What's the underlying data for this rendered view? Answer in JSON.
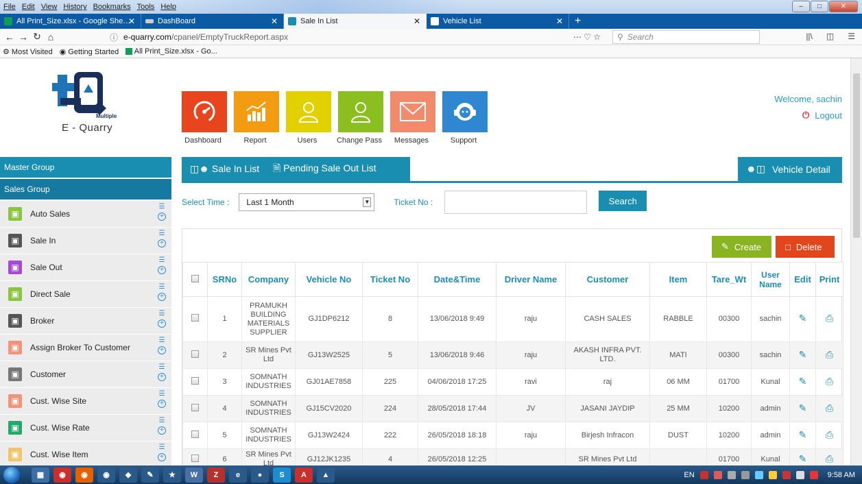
{
  "browser": {
    "menu": [
      "File",
      "Edit",
      "View",
      "History",
      "Bookmarks",
      "Tools",
      "Help"
    ],
    "tabs": [
      {
        "label": "All Print_Size.xlsx - Google She…",
        "color": "#0f9d58"
      },
      {
        "label": "DashBoard",
        "color": "#cccccc"
      },
      {
        "label": "Sale In List",
        "color": "#1a8eb0"
      },
      {
        "label": "Vehicle List",
        "color": "#1a8eb0"
      }
    ],
    "new_tab": "+",
    "url_domain": "e-quarry.com",
    "url_path": "/cpanel/EmptyTruckReport.aspx",
    "search_placeholder": "Search",
    "bookmarks": [
      "Most Visited",
      "Getting Started",
      "All Print_Size.xlsx - Go..."
    ]
  },
  "header": {
    "logo_brand": "E - Quarry",
    "logo_sub": "Multiple",
    "tiles": [
      {
        "label": "Dashboard",
        "color": "#e8451e",
        "icon": "speedometer-icon"
      },
      {
        "label": "Report",
        "color": "#f39c12",
        "icon": "bar-chart-icon"
      },
      {
        "label": "Users",
        "color": "#e3d000",
        "icon": "user-icon"
      },
      {
        "label": "Change Pass",
        "color": "#8bbf1f",
        "icon": "user-key-icon"
      },
      {
        "label": "Messages",
        "color": "#f28b6b",
        "icon": "envelope-icon"
      },
      {
        "label": "Support",
        "color": "#2f86d1",
        "icon": "headset-icon"
      }
    ],
    "welcome": "Welcome, sachin",
    "logout": "Logout"
  },
  "sidebar": {
    "master_group": "Master Group",
    "sales_group": "Sales Group",
    "items": [
      {
        "label": "Auto Sales",
        "color": "#8ac53f",
        "icon": "auto-sales-icon"
      },
      {
        "label": "Sale In",
        "color": "#555555",
        "icon": "sale-in-icon"
      },
      {
        "label": "Sale Out",
        "color": "#a64ad6",
        "icon": "sale-out-icon"
      },
      {
        "label": "Direct Sale",
        "color": "#8ac53f",
        "icon": "direct-sale-icon"
      },
      {
        "label": "Broker",
        "color": "#555555",
        "icon": "broker-icon"
      },
      {
        "label": "Assign Broker To Customer",
        "color": "#f4937a",
        "icon": "assign-broker-icon"
      },
      {
        "label": "Customer",
        "color": "#777777",
        "icon": "customer-icon"
      },
      {
        "label": "Cust. Wise Site",
        "color": "#f4937a",
        "icon": "cust-site-icon"
      },
      {
        "label": "Cust. Wise Rate",
        "color": "#22a86b",
        "icon": "cust-rate-icon"
      },
      {
        "label": "Cust. Wise Item",
        "color": "#f2c46b",
        "icon": "cust-item-icon"
      }
    ]
  },
  "main": {
    "tab_sale_in": "Sale In List",
    "tab_pending": "Pending Sale Out List",
    "tab_vehicle": "Vehicle Detail",
    "select_time_label": "Select Time :",
    "select_time_value": "Last 1 Month",
    "ticket_label": "Ticket No :",
    "ticket_value": "",
    "search": "Search",
    "create": "Create",
    "delete": "Delete",
    "columns": [
      "SRNo",
      "Company",
      "Vehicle No",
      "Ticket No",
      "Date&Time",
      "Driver Name",
      "Customer",
      "Item",
      "Tare_Wt",
      "User Name",
      "Edit",
      "Print"
    ],
    "rows": [
      {
        "sr": "1",
        "company": "PRAMUKH BUILDING MATERIALS SUPPLIER",
        "vehicle": "GJ1DP6212",
        "ticket": "8",
        "datetime": "13/06/2018 9:49",
        "driver": "raju",
        "customer": "CASH SALES",
        "item": "RABBLE",
        "tare": "00300",
        "user": "sachin"
      },
      {
        "sr": "2",
        "company": "SR Mines Pvt Ltd",
        "vehicle": "GJ13W2525",
        "ticket": "5",
        "datetime": "13/06/2018 9:46",
        "driver": "raju",
        "customer": "AKASH INFRA PVT. LTD.",
        "item": "MATI",
        "tare": "00300",
        "user": "sachin"
      },
      {
        "sr": "3",
        "company": "SOMNATH INDUSTRIES",
        "vehicle": "GJ01AE7858",
        "ticket": "225",
        "datetime": "04/06/2018 17:25",
        "driver": "ravi",
        "customer": "raj",
        "item": "06 MM",
        "tare": "01700",
        "user": "Kunal"
      },
      {
        "sr": "4",
        "company": "SOMNATH INDUSTRIES",
        "vehicle": "GJ15CV2020",
        "ticket": "224",
        "datetime": "28/05/2018 17:44",
        "driver": "JV",
        "customer": "JASANI JAYDIP",
        "item": "25 MM",
        "tare": "10200",
        "user": "admin"
      },
      {
        "sr": "5",
        "company": "SOMNATH INDUSTRIES",
        "vehicle": "GJ13W2424",
        "ticket": "222",
        "datetime": "26/05/2018 18:18",
        "driver": "raju",
        "customer": "Birjesh Infracon",
        "item": "DUST",
        "tare": "10200",
        "user": "admin"
      },
      {
        "sr": "6",
        "company": "SR Mines Pvt Ltd",
        "vehicle": "GJ12JK1235",
        "ticket": "4",
        "datetime": "26/05/2018 12:25",
        "driver": "",
        "customer": "SR Mines Pvt Ltd",
        "item": "",
        "tare": "01700",
        "user": "Kunal"
      }
    ]
  },
  "taskbar": {
    "lang": "EN",
    "time": "9:58 AM"
  }
}
